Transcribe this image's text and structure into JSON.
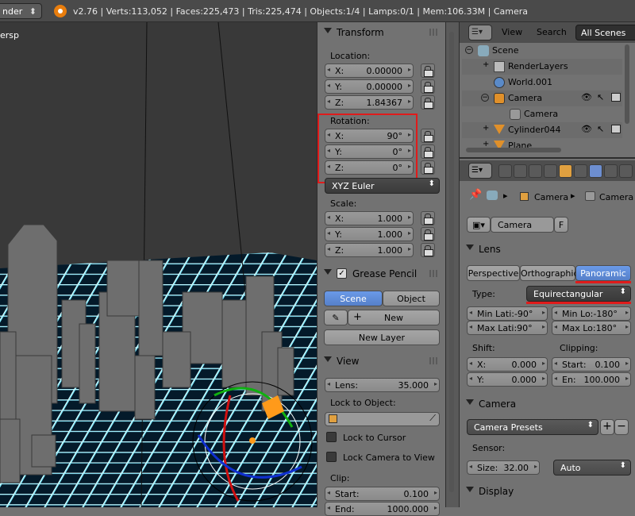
{
  "topbar": {
    "engine": "nder",
    "stats": "v2.76 | Verts:113,052 | Faces:225,473 | Tris:225,474 | Objects:1/4 | Lamps:0/1 | Mem:106.33M | Camera"
  },
  "viewport": {
    "label": "ersp"
  },
  "npanel": {
    "transform": {
      "title": "Transform",
      "location_label": "Location:",
      "loc_x": "X:",
      "loc_x_val": "0.00000",
      "loc_y": "Y:",
      "loc_y_val": "0.00000",
      "loc_z": "Z:",
      "loc_z_val": "1.84367",
      "rotation_label": "Rotation:",
      "rot_x": "X:",
      "rot_x_val": "90°",
      "rot_y": "Y:",
      "rot_y_val": "0°",
      "rot_z": "Z:",
      "rot_z_val": "0°",
      "rot_mode": "XYZ Euler",
      "scale_label": "Scale:",
      "sc_x": "X:",
      "sc_x_val": "1.000",
      "sc_y": "Y:",
      "sc_y_val": "1.000",
      "sc_z": "Z:",
      "sc_z_val": "1.000"
    },
    "grease": {
      "title": "Grease Pencil",
      "scene_tab": "Scene",
      "object_tab": "Object",
      "new_btn": "New",
      "new_layer_btn": "New Layer"
    },
    "view": {
      "title": "View",
      "lens_label": "Lens:",
      "lens_val": "35.000",
      "lock_obj_label": "Lock to Object:",
      "lock_cursor": "Lock to Cursor",
      "lock_camera": "Lock Camera to View",
      "clip_label": "Clip:",
      "clip_start": "Start:",
      "clip_start_val": "0.100",
      "clip_end": "End:",
      "clip_end_val": "1000.000"
    }
  },
  "outliner": {
    "view": "View",
    "search": "Search",
    "scenes": "All Scenes",
    "items": [
      "Scene",
      "RenderLayers",
      "World.001",
      "Camera",
      "Camera",
      "Cylinder044",
      "Plane"
    ]
  },
  "props": {
    "breadcrumb_obj": "Camera",
    "breadcrumb_data": "Camera",
    "datablock": "Camera",
    "fake_user": "F",
    "lens": {
      "title": "Lens",
      "perspective": "Perspective",
      "orthographic": "Orthographic",
      "panoramic": "Panoramic",
      "type_label": "Type:",
      "type_val": "Equirectangular",
      "min_lat": "Min Lati:-90°",
      "max_lat": "Max Lati:90°",
      "min_lon": "Min Lo:-180°",
      "max_lon": "Max Lo:180°",
      "shift_label": "Shift:",
      "shift_x": "X:",
      "shift_x_val": "0.000",
      "shift_y": "Y:",
      "shift_y_val": "0.000",
      "clip_label": "Clipping:",
      "clip_start": "Start:",
      "clip_start_val": "0.100",
      "clip_end": "En:",
      "clip_end_val": "100.000"
    },
    "camera": {
      "title": "Camera",
      "presets": "Camera Presets",
      "sensor_label": "Sensor:",
      "size": "Size:",
      "size_val": "32.00",
      "fit": "Auto"
    },
    "display": {
      "title": "Display"
    }
  }
}
